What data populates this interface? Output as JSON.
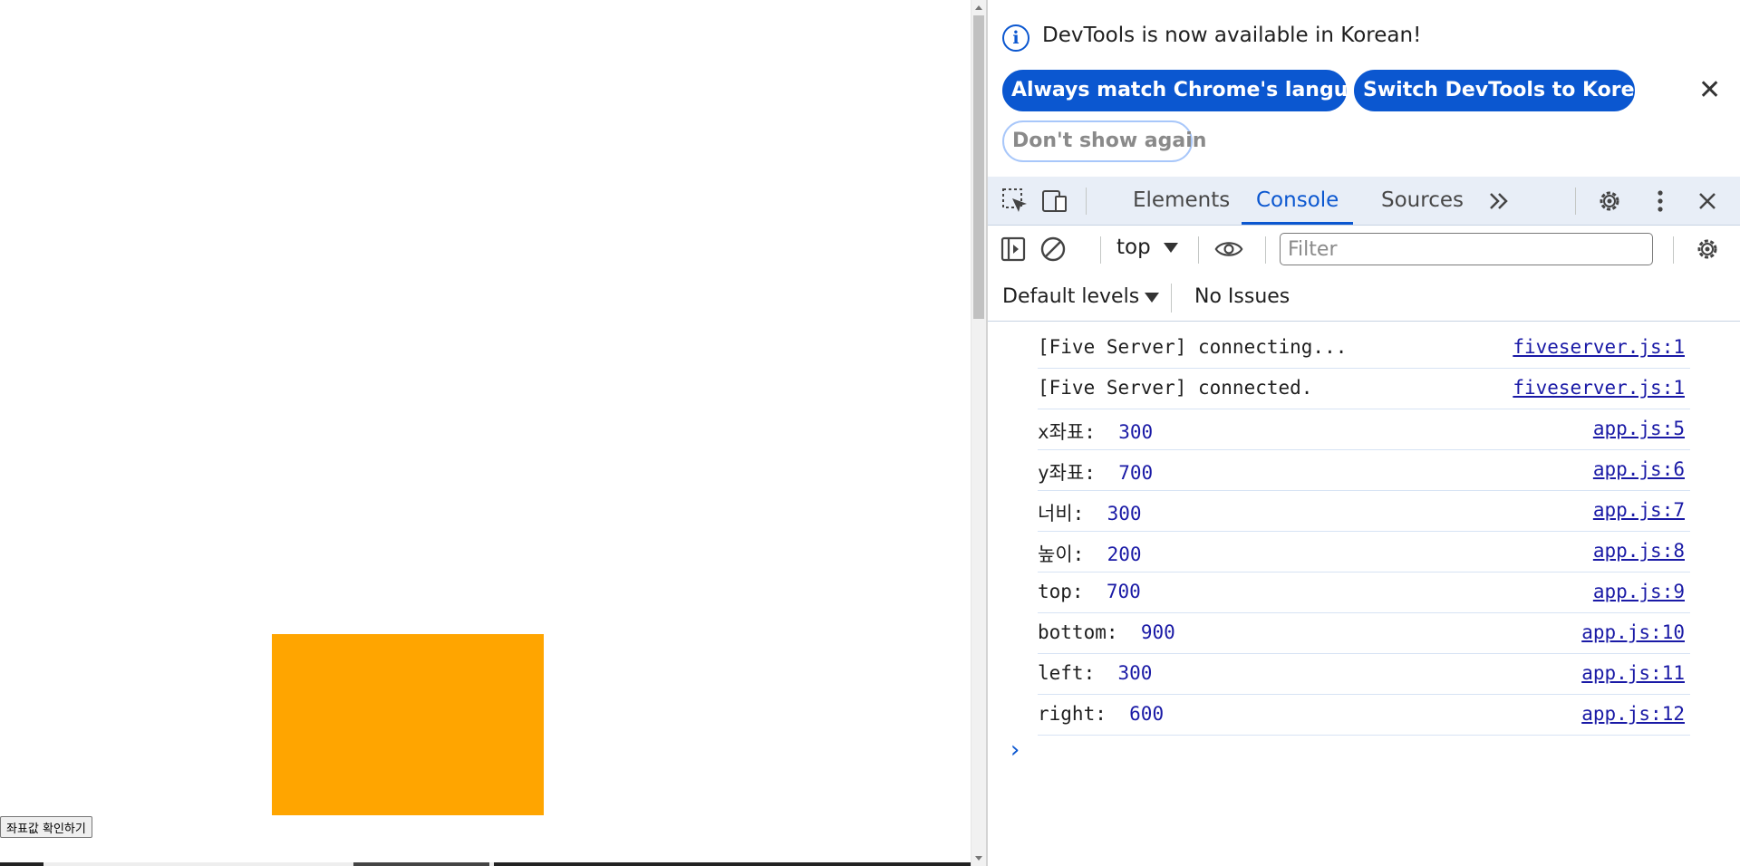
{
  "page": {
    "box_color": "#ffa500",
    "button_label": "좌표값 확인하기"
  },
  "devtools": {
    "infobar": {
      "message": "DevTools is now available in Korean!",
      "always_match_label": "Always match Chrome's language",
      "switch_label": "Switch DevTools to Korean",
      "dont_show_label": "Don't show again"
    },
    "tabs": [
      {
        "label": "Elements",
        "active": false
      },
      {
        "label": "Console",
        "active": true
      },
      {
        "label": "Sources",
        "active": false
      }
    ],
    "toolbar": {
      "context": "top",
      "filter_placeholder": "Filter"
    },
    "levels": {
      "label": "Default levels",
      "issues": "No Issues"
    },
    "console": [
      {
        "text": "[Five Server] connecting...",
        "value": "",
        "source": "fiveserver.js:1"
      },
      {
        "text": "[Five Server] connected.",
        "value": "",
        "source": "fiveserver.js:1"
      },
      {
        "text": "x좌표:",
        "value": "300",
        "source": "app.js:5"
      },
      {
        "text": "y좌표:",
        "value": "700",
        "source": "app.js:6"
      },
      {
        "text": "너비:",
        "value": "300",
        "source": "app.js:7"
      },
      {
        "text": "높이:",
        "value": "200",
        "source": "app.js:8"
      },
      {
        "text": "top:",
        "value": "700",
        "source": "app.js:9"
      },
      {
        "text": "bottom:",
        "value": "900",
        "source": "app.js:10"
      },
      {
        "text": "left:",
        "value": "300",
        "source": "app.js:11"
      },
      {
        "text": "right:",
        "value": "600",
        "source": "app.js:12"
      }
    ],
    "accent_color": "#0b57d0",
    "link_color": "#1a1aa6"
  }
}
